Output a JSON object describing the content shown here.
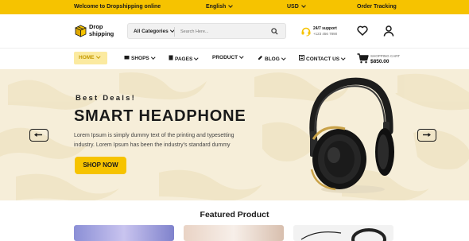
{
  "topbar": {
    "welcome": "Welcome to Dropshipping online",
    "language": "English",
    "currency": "USD",
    "order_tracking": "Order Tracking"
  },
  "header": {
    "logo_line1": "Drop",
    "logo_line2": "shipping",
    "category_select": "All Categories",
    "search_placeholder": "Search Here...",
    "support_title": "24/7 support",
    "support_phone": "+123 456 7890"
  },
  "nav": {
    "items": [
      {
        "label": "HOME"
      },
      {
        "label": "SHOPS"
      },
      {
        "label": "PAGES"
      },
      {
        "label": "PRODUCT"
      },
      {
        "label": "BLOG"
      },
      {
        "label": "CONTACT US"
      }
    ],
    "cart_label": "SHOPPING CART",
    "cart_amount": "$850.00"
  },
  "hero": {
    "eyebrow": "Best Deals!",
    "title": "SMART HEADPHONE",
    "description": "Lorem Ipsum is simply dummy text of the printing and typesetting industry. Lorem Ipsum has been the industry's standard dummy",
    "cta": "SHOP NOW"
  },
  "featured": {
    "title": "Featured Product"
  },
  "colors": {
    "accent": "#f6c300",
    "hero_bg": "#f6eed9",
    "home_highlight": "#fbeaa0"
  }
}
